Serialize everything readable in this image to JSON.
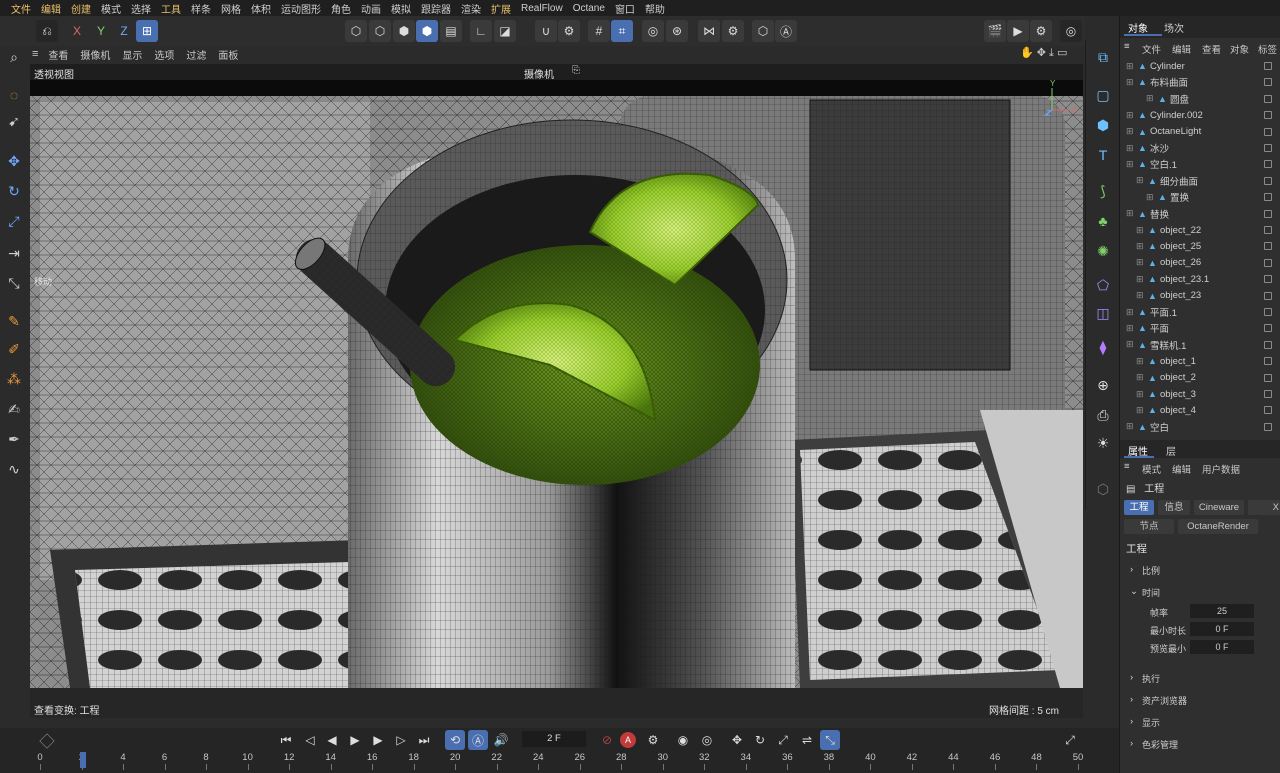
{
  "menu": [
    "文件",
    "编辑",
    "创建",
    "模式",
    "选择",
    "工具",
    "样条",
    "网格",
    "体积",
    "运动图形",
    "角色",
    "动画",
    "模拟",
    "跟踪器",
    "渲染",
    "扩展",
    "RealFlow",
    "Octane",
    "窗口",
    "帮助"
  ],
  "menu_highlight": [
    "文件",
    "编辑",
    "创建",
    "工具",
    "扩展"
  ],
  "toolbar": {
    "axis_x": "X",
    "axis_y": "Y",
    "axis_z": "Z"
  },
  "viewport_menu": [
    "查看",
    "摄像机",
    "显示",
    "选项",
    "过滤",
    "面板"
  ],
  "viewport": {
    "title": "透视视图",
    "camera_label": "摄像机",
    "hud_move": "移动",
    "footer_left": "查看变换: 工程",
    "footer_right": "网格间距 : 5 cm",
    "axis_x": "X",
    "axis_y": "Y",
    "axis_z": "Z"
  },
  "object_manager": {
    "tabs": [
      "对象",
      "场次"
    ],
    "menu": [
      "文件",
      "编辑",
      "查看",
      "对象",
      "标签"
    ],
    "rows": [
      {
        "label": "Cylinder",
        "indent": 0
      },
      {
        "label": "布料曲面",
        "indent": 0
      },
      {
        "label": "圆盘",
        "indent": 2
      },
      {
        "label": "Cylinder.002",
        "indent": 0
      },
      {
        "label": "OctaneLight",
        "indent": 0
      },
      {
        "label": "冰沙",
        "indent": 0
      },
      {
        "label": "空白.1",
        "indent": 0
      },
      {
        "label": "细分曲面",
        "indent": 1
      },
      {
        "label": "置换",
        "indent": 2
      },
      {
        "label": "替换",
        "indent": 0
      },
      {
        "label": "object_22",
        "indent": 1
      },
      {
        "label": "object_25",
        "indent": 1
      },
      {
        "label": "object_26",
        "indent": 1
      },
      {
        "label": "object_23.1",
        "indent": 1
      },
      {
        "label": "object_23",
        "indent": 1
      },
      {
        "label": "平面.1",
        "indent": 0
      },
      {
        "label": "平面",
        "indent": 0
      },
      {
        "label": "雪糕机.1",
        "indent": 0
      },
      {
        "label": "object_1",
        "indent": 1
      },
      {
        "label": "object_2",
        "indent": 1
      },
      {
        "label": "object_3",
        "indent": 1
      },
      {
        "label": "object_4",
        "indent": 1
      },
      {
        "label": "空白",
        "indent": 0
      }
    ]
  },
  "attributes": {
    "tabs": [
      "属性",
      "层"
    ],
    "menu": [
      "模式",
      "编辑",
      "用户数据"
    ],
    "header": "工程",
    "buttons_row1": [
      "工程",
      "信息",
      "Cineware",
      "X"
    ],
    "buttons_row2": [
      "节点",
      "OctaneRender"
    ],
    "section_title": "工程",
    "groups": [
      "比例",
      "时间",
      "执行",
      "资产浏览器",
      "显示",
      "色彩管理"
    ],
    "fields": [
      {
        "label": "帧率",
        "value": "25"
      },
      {
        "label": "最小时长",
        "value": "0 F"
      },
      {
        "label": "预览最小",
        "value": "0 F"
      }
    ]
  },
  "timeline": {
    "current_frame": "2 F",
    "ticks": [
      "0",
      "2",
      "4",
      "6",
      "8",
      "10",
      "12",
      "14",
      "16",
      "18",
      "20",
      "22",
      "24",
      "26",
      "28",
      "30",
      "32",
      "34",
      "36",
      "38",
      "40",
      "42",
      "44",
      "46",
      "48",
      "50"
    ]
  },
  "colors": {
    "accent": "#4a6fb0",
    "lime": "#8fd12a",
    "menu_highlight": "#e9c16a"
  }
}
